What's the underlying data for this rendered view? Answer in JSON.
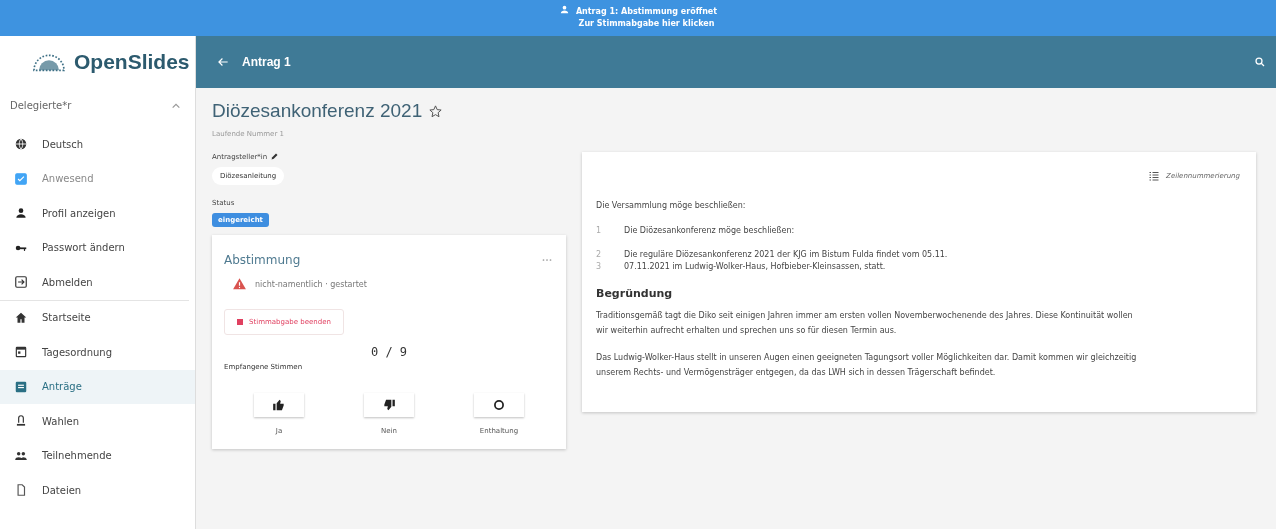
{
  "banner": {
    "lines": [
      "Antrag 1: Abstimmung eröffnet",
      "Zur Stimmabgabe hier klicken"
    ]
  },
  "logo": {
    "text": "OpenSlides"
  },
  "toolbar": {
    "title": "Antrag 1"
  },
  "sidebar": {
    "user": {
      "name": "Delegierte*r",
      "expanded": true
    },
    "user_items": [
      {
        "kind": "icon",
        "label": "Deutsch"
      },
      {
        "kind": "checkbox",
        "label": "Anwesend",
        "checked": true
      },
      {
        "kind": "icon",
        "label": "Profil anzeigen"
      },
      {
        "kind": "icon",
        "label": "Passwort ändern"
      },
      {
        "kind": "icon",
        "label": "Abmelden"
      }
    ],
    "items": [
      {
        "label": "Startseite",
        "selected": false
      },
      {
        "label": "Tagesordnung",
        "selected": false
      },
      {
        "label": "Anträge",
        "selected": true
      },
      {
        "label": "Wahlen",
        "selected": false
      },
      {
        "label": "Teilnehmende",
        "selected": false
      },
      {
        "label": "Dateien",
        "selected": false
      }
    ]
  },
  "motion": {
    "title": "Diözesankonferenz 2021",
    "favorite": false,
    "number": "Laufende Nummer 1",
    "submitter_label": "Antragsteller*in",
    "submitter": "Diözesanleitung",
    "state_label": "Status",
    "state": "eingereicht"
  },
  "poll": {
    "title": "Abstimmung",
    "status": "nicht-namentlich · gestartet",
    "stop_button": "Stimmabgabe beenden",
    "count": "0 / 9",
    "count_label": "Empfangene Stimmen",
    "options": [
      {
        "label": "Ja"
      },
      {
        "label": "Nein"
      },
      {
        "label": "Enthaltung"
      }
    ]
  },
  "text": {
    "line_numbering": "Zeilennummerierung",
    "intro": "Die Versammlung möge beschließen:",
    "lines": [
      {
        "number": "1",
        "text": "Die Diözesankonferenz möge beschließen:"
      },
      {
        "number": "2",
        "text": "Die reguläre Diözesankonferenz 2021 der KJG im Bistum Fulda findet vom 05.11."
      },
      {
        "number": "3",
        "text": "07.11.2021 im Ludwig-Wolker-Haus, Hofbieber-Kleinsassen, statt."
      }
    ],
    "reason_title": "Begründung",
    "paragraphs": [
      "Traditionsgemäß tagt die Diko seit einigen Jahren immer am ersten vollen Novemberwochenende des Jahres. Diese Kontinuität wollen wir weiterhin aufrecht erhalten und sprechen uns so für diesen Termin aus.",
      "Das Ludwig-Wolker-Haus stellt in unseren Augen einen geeigneten Tagungsort voller Möglichkeiten dar. Damit kommen wir gleichzeitig unserem Rechts- und Vermögensträger entgegen, da das LWH sich in dessen Trägerschaft befindet."
    ]
  }
}
